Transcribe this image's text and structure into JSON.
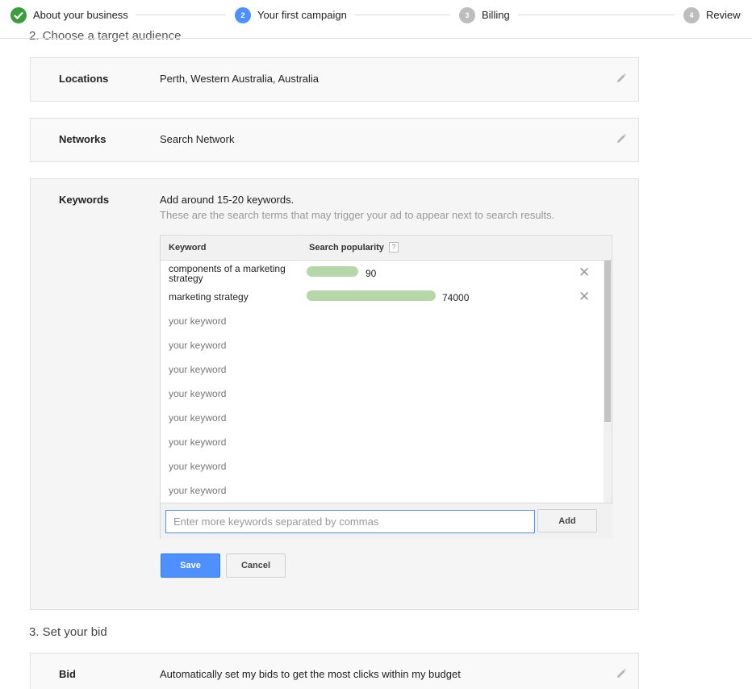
{
  "stepper": {
    "steps": [
      {
        "number": "",
        "label": "About your business",
        "state": "done",
        "icon": "check-icon"
      },
      {
        "number": "2",
        "label": "Your first campaign",
        "state": "active"
      },
      {
        "number": "3",
        "label": "Billing",
        "state": "todo"
      },
      {
        "number": "4",
        "label": "Review",
        "state": "todo"
      }
    ]
  },
  "audience": {
    "heading_clipped": "2. Choose a target audience"
  },
  "locations": {
    "label": "Locations",
    "value": "Perth, Western Australia, Australia"
  },
  "networks": {
    "label": "Networks",
    "value": "Search Network"
  },
  "keywords": {
    "label": "Keywords",
    "instruction": "Add around 15-20 keywords.",
    "hint": "These are the search terms that may trigger your ad to appear next to search results.",
    "table": {
      "col_keyword": "Keyword",
      "col_popularity": "Search popularity",
      "help": "?",
      "rows": [
        {
          "keyword": "components of a marketing strategy",
          "popularity": "90",
          "popularity_fraction": 0.4
        },
        {
          "keyword": "marketing strategy",
          "popularity": "74000",
          "popularity_fraction": 1.0
        },
        {
          "keyword": "your keyword"
        },
        {
          "keyword": "your keyword"
        },
        {
          "keyword": "your keyword"
        },
        {
          "keyword": "your keyword"
        },
        {
          "keyword": "your keyword"
        },
        {
          "keyword": "your keyword"
        },
        {
          "keyword": "your keyword"
        },
        {
          "keyword": "your keyword"
        }
      ]
    },
    "add_placeholder": "Enter more keywords separated by commas",
    "add_label": "Add",
    "save_label": "Save",
    "cancel_label": "Cancel"
  },
  "bid_section": {
    "title": "3. Set your bid",
    "label": "Bid",
    "value": "Automatically set my bids to get the most clicks within my budget"
  },
  "colors": {
    "accent": "#4d90fe",
    "done": "#3c9d3c",
    "bar": "#b6d7a8"
  }
}
